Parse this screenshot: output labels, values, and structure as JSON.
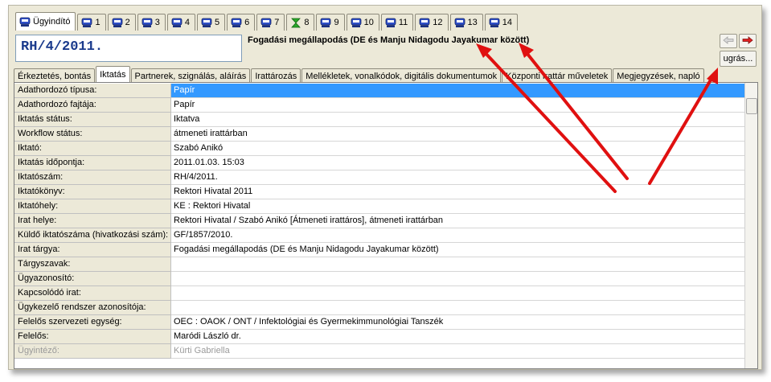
{
  "top_tabs": [
    {
      "label": "Ügyindító",
      "icon": "document-stamp-icon",
      "active": true
    },
    {
      "label": "1",
      "icon": "document-stamp-icon"
    },
    {
      "label": "2",
      "icon": "document-stamp-icon"
    },
    {
      "label": "3",
      "icon": "document-stamp-icon"
    },
    {
      "label": "4",
      "icon": "document-stamp-icon"
    },
    {
      "label": "5",
      "icon": "document-stamp-icon"
    },
    {
      "label": "6",
      "icon": "document-stamp-icon"
    },
    {
      "label": "7",
      "icon": "document-stamp-icon"
    },
    {
      "label": "8",
      "icon": "hourglass-icon"
    },
    {
      "label": "9",
      "icon": "document-stamp-icon"
    },
    {
      "label": "10",
      "icon": "document-stamp-icon"
    },
    {
      "label": "11",
      "icon": "document-stamp-icon"
    },
    {
      "label": "12",
      "icon": "document-stamp-icon"
    },
    {
      "label": "13",
      "icon": "document-stamp-icon"
    },
    {
      "label": "14",
      "icon": "document-stamp-icon"
    }
  ],
  "header": {
    "iktatoszam": "RH/4/2011.",
    "targy": "Fogadási megállapodás (DE és Manju Nidagodu Jayakumar között)",
    "jump_label": "ugrás..."
  },
  "sub_tabs": [
    {
      "label": "Érkeztetés, bontás"
    },
    {
      "label": "Iktatás",
      "active": true
    },
    {
      "label": "Partnerek, szignálás, aláírás"
    },
    {
      "label": "Irattározás"
    },
    {
      "label": "Mellékletek, vonalkódok, digitális dokumentumok"
    },
    {
      "label": "Központi irattár műveletek"
    },
    {
      "label": "Megjegyzések, napló"
    }
  ],
  "fields": [
    {
      "label": "Adathordozó típusa:",
      "value": "Papír",
      "selected": true
    },
    {
      "label": "Adathordozó fajtája:",
      "value": "Papír"
    },
    {
      "label": "Iktatás státus:",
      "value": "Iktatva"
    },
    {
      "label": "Workflow státus:",
      "value": "átmeneti irattárban"
    },
    {
      "label": "Iktató:",
      "value": "Szabó Anikó"
    },
    {
      "label": "Iktatás időpontja:",
      "value": "2011.01.03. 15:03"
    },
    {
      "label": "Iktatószám:",
      "value": "RH/4/2011."
    },
    {
      "label": "Iktatókönyv:",
      "value": "Rektori Hivatal 2011"
    },
    {
      "label": "Iktatóhely:",
      "value": "KE : Rektori Hivatal"
    },
    {
      "label": "Irat helye:",
      "value": "Rektori Hivatal / Szabó Anikó [Átmeneti irattáros], átmeneti irattárban"
    },
    {
      "label": "Küldő iktatószáma (hivatkozási szám):",
      "value": "GF/1857/2010."
    },
    {
      "label": "Irat tárgya:",
      "value": "Fogadási megállapodás (DE és Manju Nidagodu Jayakumar között)"
    },
    {
      "label": "Tárgyszavak:",
      "value": ""
    },
    {
      "label": "Ügyazonosító:",
      "value": ""
    },
    {
      "label": "Kapcsolódó irat:",
      "value": ""
    },
    {
      "label": "Ügykezelő rendszer azonosítója:",
      "value": ""
    },
    {
      "label": "Felelős szervezeti egység:",
      "value": "OEC : OAOK / ONT / Infektológiai és Gyermekimmunológiai Tanszék"
    },
    {
      "label": "Felelős:",
      "value": "Maródi László dr."
    },
    {
      "label": "Ügyintéző:",
      "value": "Kürti Gabriella",
      "dim": true
    }
  ],
  "colors": {
    "selection": "#3399ff",
    "annotation_arrow": "#e01010",
    "iktatoszam_text": "#1a3a8c"
  }
}
